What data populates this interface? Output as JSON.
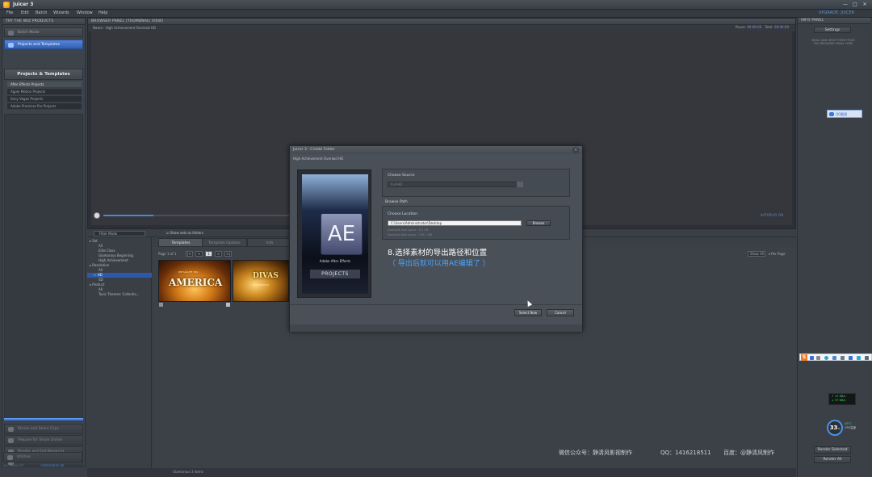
{
  "window": {
    "title": "Juicer 3",
    "controls": [
      "—",
      "□",
      "✕"
    ]
  },
  "menu": {
    "items": [
      "File",
      "Edit",
      "Batch",
      "Wizards",
      "Window",
      "Help"
    ],
    "status": "UPGRADE: JUICER"
  },
  "left_panel": {
    "header": "TRY THE WIZ PRODUCTS",
    "top_button": "Batch Mode",
    "projects_button": "Projects and Templates",
    "section_title": "Projects & Templates",
    "sub_items": [
      "After Effects Projects",
      "Apple Motion Projects",
      "Sony Vegas Projects",
      "Adobe Premiere Pro Projects"
    ],
    "bottom_buttons": [
      "Shrink and Share Clips",
      "Prepare for Share Online",
      "Render and Get Blueprint",
      "Tools",
      "Utilities"
    ],
    "footer": {
      "left": "v3.0 Build 127",
      "right": "CATEGORIZE HD"
    }
  },
  "viewer": {
    "header": "BROWSER PANEL (THUMBNAIL VIEW)",
    "name_label": "Name : High Achievement Overlaid HD",
    "pause_label": "Pause:",
    "pause_value": "00:00:00",
    "total_label": "Total:",
    "total_value": "00:00:00",
    "seek_right": "AUTOPLAY ON"
  },
  "browser": {
    "filter_placeholder": "Filter Mode",
    "show_folders": "Show sets as folders",
    "tabs": [
      "Templates",
      "Template Options",
      "Info"
    ],
    "page_label": "Page 1 of 1",
    "page_buttons": [
      "|<",
      "<",
      "1",
      ">",
      ">|"
    ],
    "show_all": "Show All",
    "per_page": "Per Page",
    "tree": [
      {
        "label": "Set",
        "level": 0,
        "selected": false
      },
      {
        "label": "All",
        "level": 1,
        "selected": false
      },
      {
        "label": "Elite Class",
        "level": 1,
        "selected": false
      },
      {
        "label": "Glamorous Beginning",
        "level": 1,
        "selected": false
      },
      {
        "label": "High Achievement",
        "level": 1,
        "selected": false
      },
      {
        "label": "Resolution",
        "level": 0,
        "selected": false
      },
      {
        "label": "All",
        "level": 1,
        "selected": false
      },
      {
        "label": "HD",
        "level": 1,
        "selected": true
      },
      {
        "label": "SD",
        "level": 1,
        "selected": false
      },
      {
        "label": "Product",
        "level": 0,
        "selected": false
      },
      {
        "label": "All",
        "level": 1,
        "selected": false
      },
      {
        "label": "Toxic Themes: Collectio...",
        "level": 1,
        "selected": false
      }
    ],
    "thumbnails": [
      {
        "title": "AMERICA",
        "subtitle": "WE SALUTE YOU"
      },
      {
        "title": "DIVAS",
        "subtitle": "GLAMOROUS"
      }
    ],
    "status": "Glamorous 3 items"
  },
  "right_panel": {
    "header": "INFO PANEL",
    "settings_button": "Settings",
    "hint": "DRAG AND DROP ITEMS FROM THE BROWSER PANEL HERE",
    "qq_label": "QQ截图",
    "net_up": "↑ 12 KB/s",
    "net_down": "↓ 37 KB/s",
    "gauge_value": "33",
    "gauge_unit": "%",
    "cpu_temp": "49°C",
    "cpu_label": "CPU温度",
    "render_selected": "Render Selected",
    "render_all": "Render All"
  },
  "dialog": {
    "title": "Juicer 3 - Create Folder",
    "subtitle": "High Achievement Overlaid HD",
    "ae_letters": "AE",
    "ae_brand": "Adobe After Effects",
    "ae_projects": "PROJECTS",
    "choose_source_label": "Choose Source",
    "choose_source_value": "Full HD",
    "browse_path_label": "Browse Path",
    "choose_location_label": "Choose Location",
    "location_value": "C:\\Users\\Administrator\\Desktop",
    "browse_button": "Browse",
    "available_space": "Available disk space : 8.2 GB",
    "required_space": "Required disk space : 728.7 MB",
    "annotation_main": "8.选择素材的导出路径和位置",
    "annotation_sub": "（ 导出后就可以用AE编辑了 ）",
    "select_button": "Select Now",
    "cancel_button": "Cancel"
  },
  "watermark": {
    "wechat": "微信公众号：静清风影视制作",
    "qq": "QQ：1416218511",
    "baidu": "百度：@静清风制作"
  }
}
